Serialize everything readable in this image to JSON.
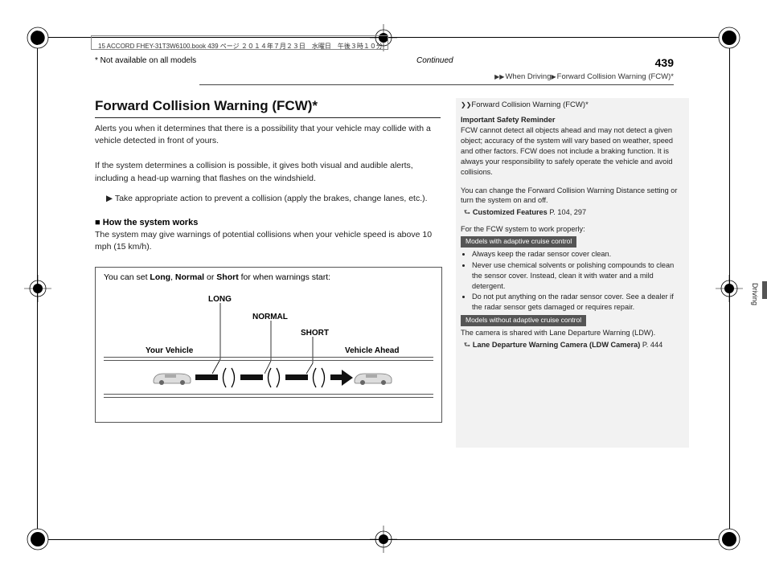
{
  "file_stamp": "15 ACCORD FHEY-31T3W6100.book  439 ページ  ２０１４年７月２３日　水曜日　午後３時１０分",
  "breadcrumb": {
    "arrow": "▶▶",
    "sec1": "When Driving",
    "sep": "▶",
    "sec2": "Forward Collision Warning (FCW)",
    "ast": "*"
  },
  "title": "Forward Collision Warning (FCW)",
  "title_ast": "*",
  "intro": "Alerts you when it determines that there is a possibility that your vehicle may collide with a vehicle detected in front of yours.",
  "para2": "If the system determines a collision is possible, it gives both visual and audible alerts, including a head-up warning that flashes on the windshield.",
  "para2b_arrow": "▶",
  "para2b": "Take appropriate action to prevent a collision (apply the brakes, change lanes, etc.).",
  "how_head_sq": "■",
  "how_head": "How the system works",
  "how_text": "The system may give warnings of potential collisions when your vehicle speed is above 10 mph (15 km/h).",
  "diagram": {
    "title_a": "You can set ",
    "title_b": "Long",
    "title_c": ", ",
    "title_d": "Normal",
    "title_e": " or ",
    "title_f": "Short",
    "title_g": " for when warnings start:",
    "long": "LONG",
    "normal": "NORMAL",
    "short": "SHORT",
    "your_vehicle": "Your Vehicle",
    "vehicle_ahead": "Vehicle Ahead"
  },
  "side": {
    "chev": "❯❯",
    "title": "Forward Collision Warning (FCW)",
    "ast": "*",
    "reminder_h": "Important Safety Reminder",
    "reminder": "FCW cannot detect all objects ahead and may not detect a given object; accuracy of the system will vary based on weather, speed and other factors. FCW does not include a braking function. It is always your responsibility to safely operate the vehicle and avoid collisions.",
    "change": "You can change the Forward Collision Warning Distance setting or turn the system on and off.",
    "ref1_icon": "⮑",
    "ref1": "Customized Features",
    "ref1_pg": " P. 104, 297",
    "proper": "For the FCW system to work properly:",
    "tag1": "Models with adaptive cruise control",
    "bul1": "Always keep the radar sensor cover clean.",
    "bul2": "Never use chemical solvents or polishing compounds to clean the sensor cover. Instead, clean it with water and a mild detergent.",
    "bul3": "Do not put anything on the radar sensor cover. See a dealer if the radar sensor gets damaged or requires repair.",
    "tag2": "Models without adaptive cruise control",
    "camera": "The camera is shared with Lane Departure Warning (LDW).",
    "ref2_icon": "⮑",
    "ref2": "Lane Departure Warning Camera (LDW Camera)",
    "ref2_pg": " P. 444"
  },
  "tab_label": "Driving",
  "foot_note": "* Not available on all models",
  "foot_cont": "Continued",
  "page_num": "439"
}
